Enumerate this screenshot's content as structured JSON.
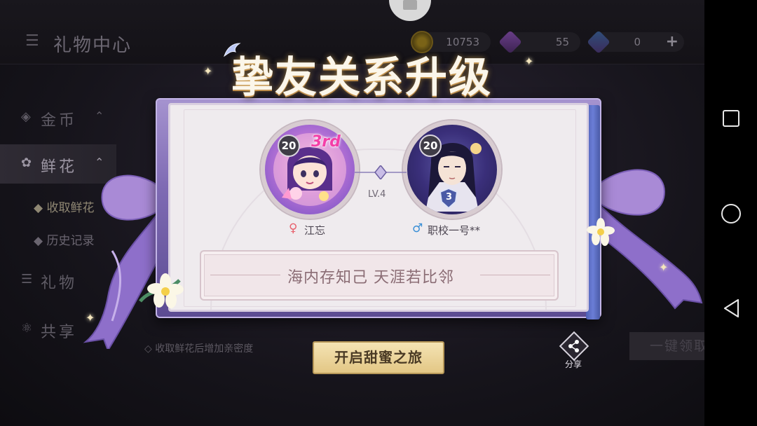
{
  "header": {
    "title": "礼物中心"
  },
  "currencies": [
    {
      "name": "gold-coin",
      "value": "10753"
    },
    {
      "name": "purple-gem",
      "value": "55"
    },
    {
      "name": "blue-crystal",
      "value": "0"
    }
  ],
  "sidebar": {
    "items": [
      {
        "label": "金币"
      },
      {
        "label": "鲜花"
      },
      {
        "label": "礼物"
      },
      {
        "label": "共享"
      }
    ],
    "sub_items": [
      {
        "label": "收取鲜花"
      },
      {
        "label": "历史记录"
      }
    ]
  },
  "hint": "收取鲜花后增加亲密度",
  "collect_all": "一键领取",
  "popup": {
    "headline": "挚友关系升级",
    "left": {
      "level": "20",
      "rank": "3rd",
      "name": "江忘"
    },
    "right": {
      "level": "20",
      "tier": "3",
      "name": "职校一号**"
    },
    "relation_level": "LV.4",
    "poem": "海内存知己  天涯若比邻",
    "start_button": "开启甜蜜之旅",
    "share_label": "分享"
  }
}
